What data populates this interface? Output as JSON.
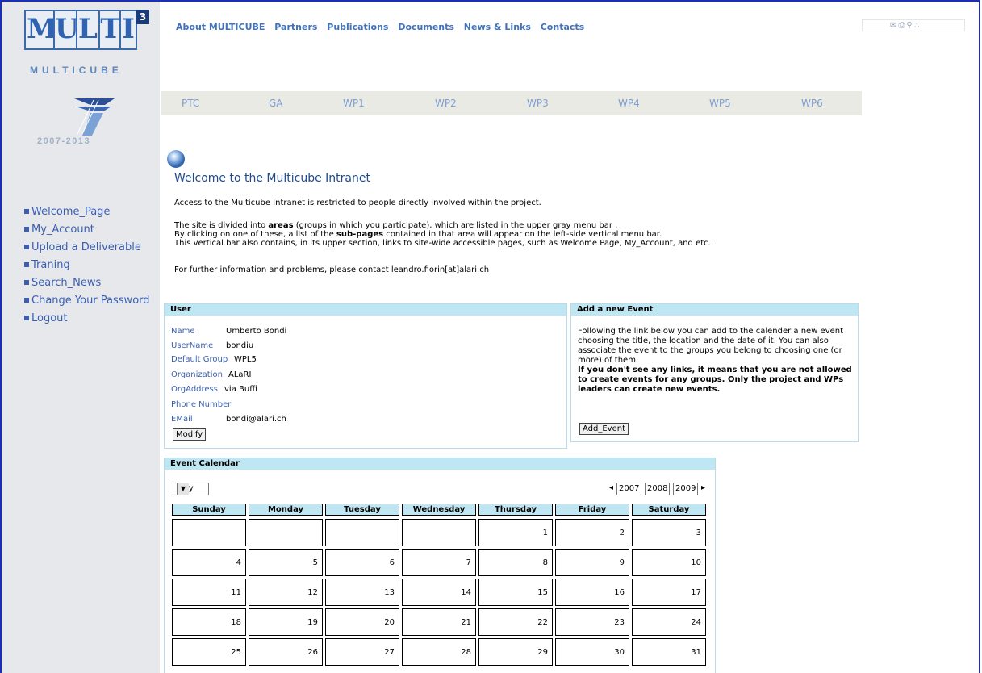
{
  "branding": {
    "logo_letters": [
      "M",
      "U",
      "L",
      "T",
      "I"
    ],
    "logo_superscript": "3",
    "logo_word": "MULTICUBE",
    "fp7_years": "2007-2013"
  },
  "top_nav": {
    "items": [
      "About MULTICUBE",
      "Partners",
      "Publications",
      "Documents",
      "News & Links",
      "Contacts"
    ]
  },
  "utility_icons": [
    "mail-icon",
    "print-icon",
    "search-icon",
    "sitemap-icon"
  ],
  "area_menu": {
    "items": [
      "PTC",
      "GA",
      "WP1",
      "WP2",
      "WP3",
      "WP4",
      "WP5",
      "WP6"
    ]
  },
  "sidebar": {
    "items": [
      "Welcome_Page",
      "My_Account",
      "Upload a Deliverable",
      "Traning",
      "Search_News",
      "Change Your Password",
      "Logout"
    ]
  },
  "welcome": {
    "title": "Welcome to the Multicube Intranet",
    "p1": "Access to the Multicube Intranet is restricted to people directly involved within the project.",
    "p2_a": "The site is divided into ",
    "p2_b": "areas",
    "p2_c": " (groups in which you participate), which are listed in the upper gray menu bar .",
    "p3_a": "By clicking on one of these, a list of the ",
    "p3_b": "sub-pages",
    "p3_c": " contained in that area will appear on the left-side vertical menu bar.",
    "p4": "This vertical bar also contains, in its upper section, links to site-wide accessible pages, such as Welcome Page, My_Account, and etc..",
    "p5": "For further information and problems, please contact leandro.fiorin[at]alari.ch"
  },
  "user_panel": {
    "title": "User",
    "fields": [
      {
        "label": "Name",
        "value": "Umberto Bondi"
      },
      {
        "label": "UserName",
        "value": "bondiu"
      },
      {
        "label": "Default Group",
        "value": "WPL5"
      },
      {
        "label": "Organization",
        "value": "ALaRI"
      },
      {
        "label": "OrgAddress",
        "value": "via Buffi"
      },
      {
        "label": "Phone Number",
        "value": ""
      },
      {
        "label": "EMail",
        "value": "bondi@alari.ch"
      }
    ],
    "modify_label": "Modify"
  },
  "event_panel": {
    "title": "Add a new Event",
    "text": "Following the link below you can add to the calender a new event choosing the title, the location and the date of it. You can also associate the event to the groups you belong to choosing one (or more) of them.",
    "bold_text": "If you don't see any links, it means that you are not allowed to create events for any groups. Only the project and WPs leaders can create new events.",
    "button_label": "Add_Event"
  },
  "calendar": {
    "title": "Event Calendar",
    "month": "May",
    "years": [
      "2007",
      "2008",
      "2009"
    ],
    "prev_symbol": "◂",
    "next_symbol": "▸",
    "days": [
      "Sunday",
      "Monday",
      "Tuesday",
      "Wednesday",
      "Thursday",
      "Friday",
      "Saturday"
    ],
    "weeks": [
      [
        "",
        "",
        "",
        "",
        "1",
        "2",
        "3"
      ],
      [
        "4",
        "5",
        "6",
        "7",
        "8",
        "9",
        "10"
      ],
      [
        "11",
        "12",
        "13",
        "14",
        "15",
        "16",
        "17"
      ],
      [
        "18",
        "19",
        "20",
        "21",
        "22",
        "23",
        "24"
      ],
      [
        "25",
        "26",
        "27",
        "28",
        "29",
        "30",
        "31"
      ]
    ]
  }
}
